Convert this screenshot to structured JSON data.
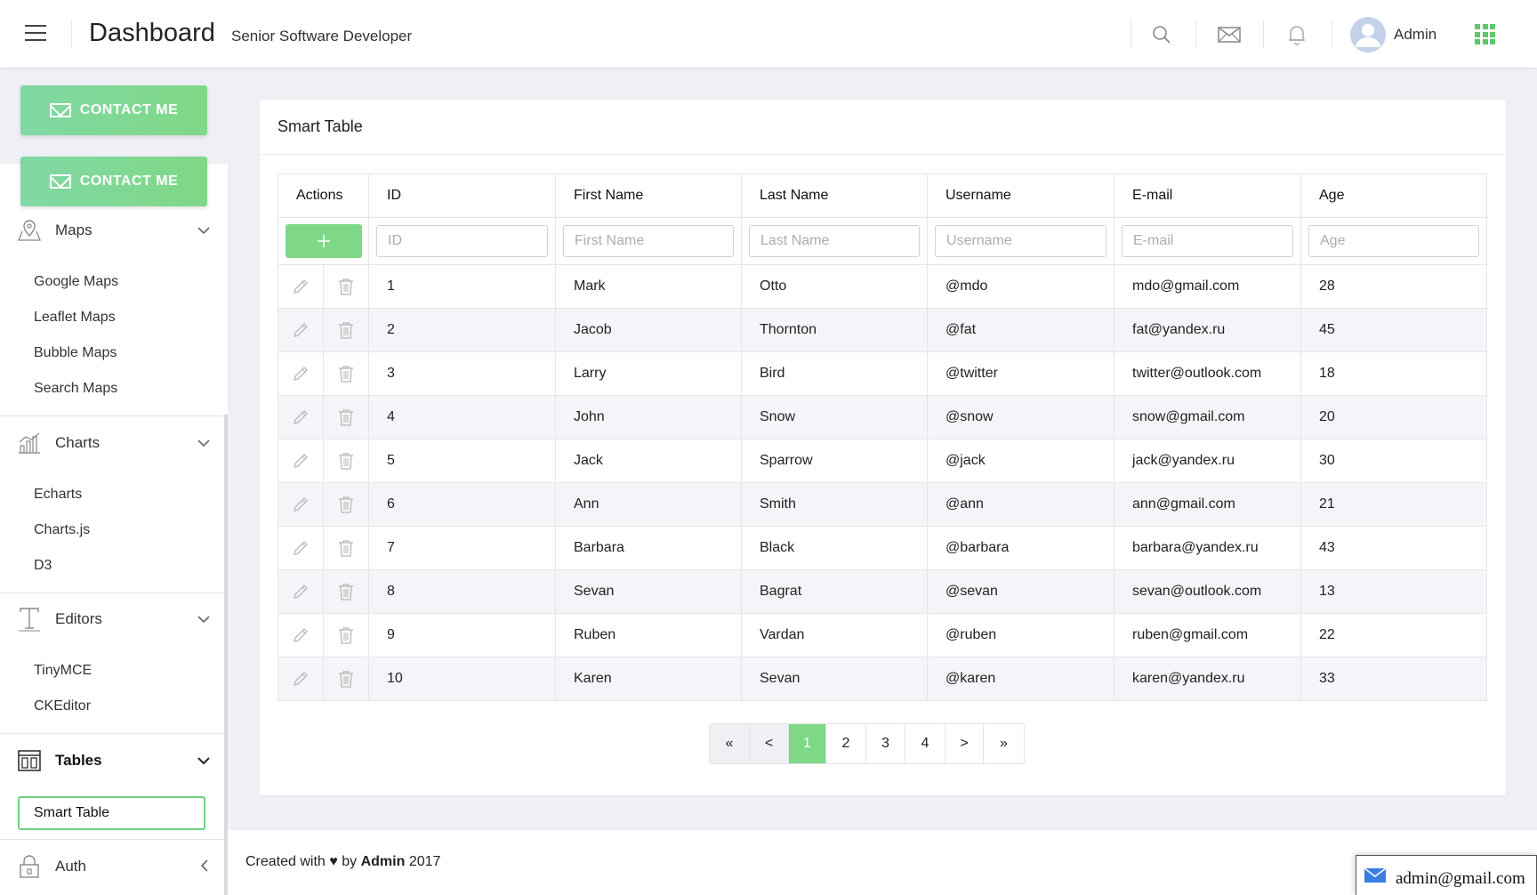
{
  "header": {
    "title": "Dashboard",
    "subtitle": "Senior Software Developer",
    "user_name": "Admin",
    "accent_color": "#7fd886"
  },
  "sidebar": {
    "contact_button_label": "CONTACT ME",
    "groups": [
      {
        "label": "Maps",
        "icon": "map-pin-icon",
        "items": [
          "Google Maps",
          "Leaflet Maps",
          "Bubble Maps",
          "Search Maps"
        ]
      },
      {
        "label": "Charts",
        "icon": "bar-chart-icon",
        "items": [
          "Echarts",
          "Charts.js",
          "D3"
        ]
      },
      {
        "label": "Editors",
        "icon": "text-editor-icon",
        "items": [
          "TinyMCE",
          "CKEditor"
        ]
      },
      {
        "label": "Tables",
        "icon": "table-icon",
        "items": [
          "Smart Table"
        ]
      },
      {
        "label": "Auth",
        "icon": "lock-icon",
        "items": []
      }
    ],
    "active_item": "Smart Table"
  },
  "card": {
    "title": "Smart Table",
    "columns": [
      "Actions",
      "ID",
      "First Name",
      "Last Name",
      "Username",
      "E-mail",
      "Age"
    ],
    "filters": {
      "id": "ID",
      "first_name": "First Name",
      "last_name": "Last Name",
      "username": "Username",
      "email": "E-mail",
      "age": "Age"
    },
    "rows": [
      [
        "1",
        "Mark",
        "Otto",
        "@mdo",
        "mdo@gmail.com",
        "28"
      ],
      [
        "2",
        "Jacob",
        "Thornton",
        "@fat",
        "fat@yandex.ru",
        "45"
      ],
      [
        "3",
        "Larry",
        "Bird",
        "@twitter",
        "twitter@outlook.com",
        "18"
      ],
      [
        "4",
        "John",
        "Snow",
        "@snow",
        "snow@gmail.com",
        "20"
      ],
      [
        "5",
        "Jack",
        "Sparrow",
        "@jack",
        "jack@yandex.ru",
        "30"
      ],
      [
        "6",
        "Ann",
        "Smith",
        "@ann",
        "ann@gmail.com",
        "21"
      ],
      [
        "7",
        "Barbara",
        "Black",
        "@barbara",
        "barbara@yandex.ru",
        "43"
      ],
      [
        "8",
        "Sevan",
        "Bagrat",
        "@sevan",
        "sevan@outlook.com",
        "13"
      ],
      [
        "9",
        "Ruben",
        "Vardan",
        "@ruben",
        "ruben@gmail.com",
        "22"
      ],
      [
        "10",
        "Karen",
        "Sevan",
        "@karen",
        "karen@yandex.ru",
        "33"
      ]
    ],
    "pagination": [
      "«",
      "<",
      "1",
      "2",
      "3",
      "4",
      ">",
      "»"
    ],
    "current_page": "1"
  },
  "footer": {
    "text_before": "Created with",
    "heart": "♥",
    "text_by": "by",
    "author": "Admin",
    "year": "2017"
  },
  "mail_popup": {
    "email": "admin@gmail.com"
  }
}
